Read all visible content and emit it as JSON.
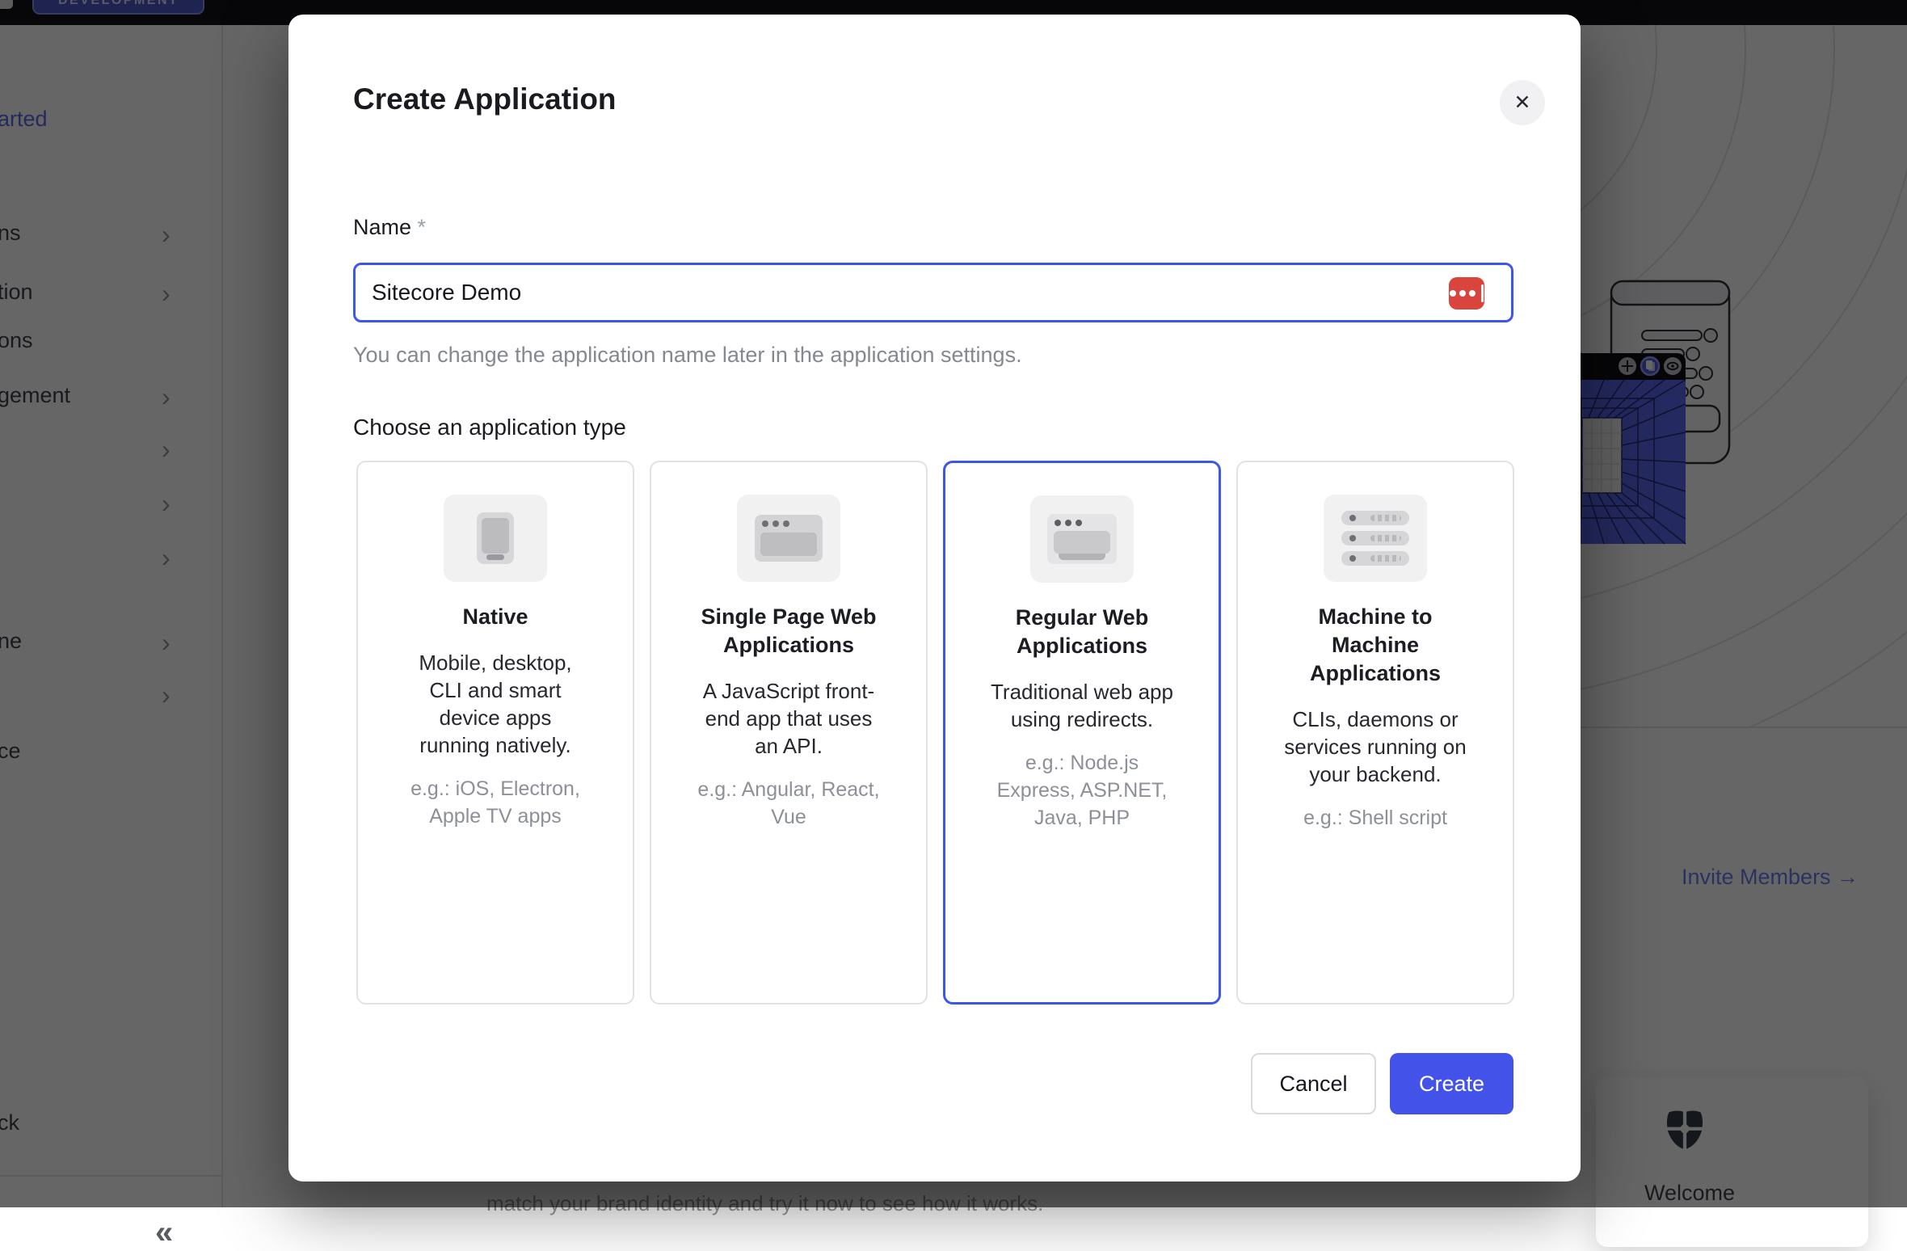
{
  "topbar": {
    "badge_label": "DEVELOPMENT"
  },
  "sidebar": {
    "chevron_glyph": "›",
    "collapse_glyph": "«",
    "items": [
      {
        "label": "arted"
      },
      {
        "label": "ns"
      },
      {
        "label": "tion"
      },
      {
        "label": "ons"
      },
      {
        "label": "gement"
      },
      {
        "label": ""
      },
      {
        "label": ""
      },
      {
        "label": ""
      },
      {
        "label": "ne"
      },
      {
        "label": ""
      },
      {
        "label": "ce"
      },
      {
        "label": "ck"
      }
    ]
  },
  "modal": {
    "title": "Create Application",
    "close_glyph": "✕",
    "name_field": {
      "label": "Name",
      "required_marker": " *",
      "value": "Sitecore Demo"
    },
    "helper": "You can change the application name later in the application settings.",
    "type_label": "Choose an application type",
    "cards": [
      {
        "title": "Native",
        "description": "Mobile, desktop, CLI and smart device apps running natively.",
        "example": "e.g.: iOS, Electron, Apple TV apps",
        "icon": "mobile-phone-icon",
        "selected": false
      },
      {
        "title": "Single Page Web Applications",
        "description": "A JavaScript front-end app that uses an API.",
        "example": "e.g.: Angular, React, Vue",
        "icon": "browser-window-icon",
        "selected": false
      },
      {
        "title": "Regular Web Applications",
        "description": "Traditional web app using redirects.",
        "example": "e.g.: Node.js Express, ASP.NET, Java, PHP",
        "icon": "server-window-icon",
        "selected": true
      },
      {
        "title": "Machine to Machine Applications",
        "description": "CLIs, daemons or services running on your backend.",
        "example": "e.g.: Shell script",
        "icon": "server-stack-icon",
        "selected": false
      }
    ],
    "cancel_label": "Cancel",
    "create_label": "Create"
  },
  "background": {
    "invite_link": "Invite Members →",
    "welcome_card": {
      "title": "Welcome"
    },
    "clipped_text": "match your brand identity and try it now to see how it works."
  },
  "colors": {
    "accent": "#4353e9",
    "input_border": "#3d56ec",
    "selected_card_border": "#3d56ec",
    "autofill_icon": "#d9453c",
    "badge_background": "#4d58c9",
    "overlay": "rgba(0,0,0,0.60)"
  }
}
